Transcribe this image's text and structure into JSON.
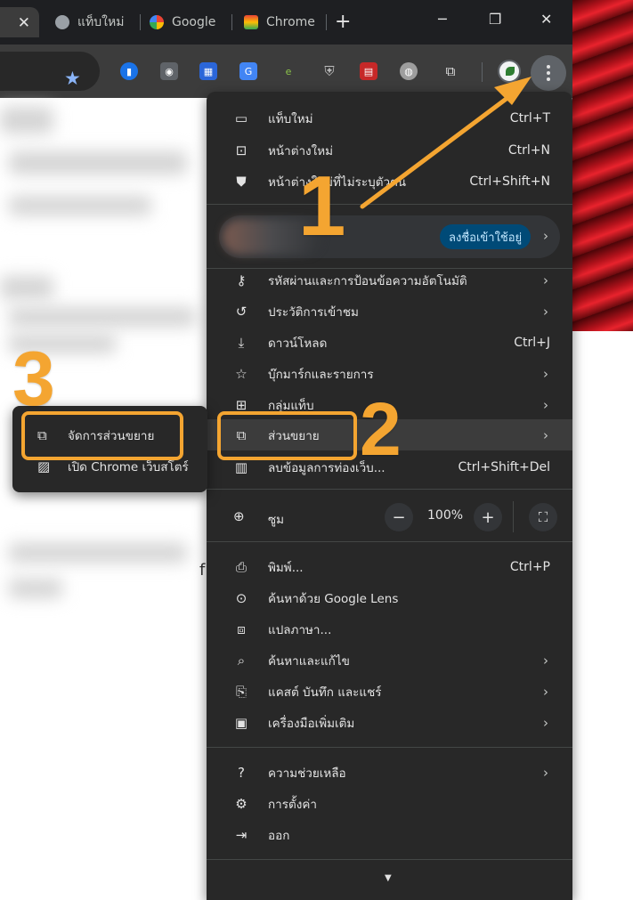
{
  "tabs": [
    {
      "label": "",
      "close": "✕"
    },
    {
      "label": "แท็บใหม่"
    },
    {
      "label": "Google"
    },
    {
      "label": "Chrome"
    }
  ],
  "newtab_icon": "+",
  "window": {
    "minimize": "─",
    "restore": "❐",
    "close": "✕"
  },
  "menu": {
    "section1": [
      {
        "label": "แท็บใหม่",
        "shortcut": "Ctrl+T",
        "icon": "new-tab-icon"
      },
      {
        "label": "หน้าต่างใหม่",
        "shortcut": "Ctrl+N",
        "icon": "new-window-icon"
      },
      {
        "label": "หน้าต่างใหม่ที่ไม่ระบุตัวตน",
        "shortcut": "Ctrl+Shift+N",
        "icon": "incognito-icon"
      }
    ],
    "signin_label": "ลงชื่อเข้าใช้อยู่",
    "section2": [
      {
        "label": "รหัสผ่านและการป้อนข้อความอัตโนมัติ",
        "shortcut": "",
        "icon": "key-icon"
      },
      {
        "label": "ประวัติการเข้าชม",
        "shortcut": "",
        "icon": "history-icon"
      },
      {
        "label": "ดาวน์โหลด",
        "shortcut": "Ctrl+J",
        "icon": "download-icon"
      },
      {
        "label": "บุ๊กมาร์กและรายการ",
        "shortcut": "",
        "icon": "star-icon"
      },
      {
        "label": "กลุ่มแท็บ",
        "shortcut": "",
        "icon": "grid-icon"
      },
      {
        "label": "ส่วนขยาย",
        "shortcut": "",
        "icon": "puzzle-icon"
      },
      {
        "label": "ลบข้อมูลการท่องเว็บ...",
        "shortcut": "Ctrl+Shift+Del",
        "icon": "trash-icon"
      }
    ],
    "zoom": {
      "label": "ซูม",
      "value": "100%",
      "minus": "−",
      "plus": "+"
    },
    "section3": [
      {
        "label": "พิมพ์...",
        "shortcut": "Ctrl+P",
        "icon": "print-icon"
      },
      {
        "label": "ค้นหาด้วย Google Lens",
        "shortcut": "",
        "icon": "lens-icon"
      },
      {
        "label": "แปลภาษา...",
        "shortcut": "",
        "icon": "translate-icon"
      },
      {
        "label": "ค้นหาและแก้ไข",
        "shortcut": "",
        "icon": "find-icon"
      },
      {
        "label": "แคสต์ บันทึก และแชร์",
        "shortcut": "",
        "icon": "cast-icon"
      },
      {
        "label": "เครื่องมือเพิ่มเติม",
        "shortcut": "",
        "icon": "toolbox-icon"
      }
    ],
    "section4": [
      {
        "label": "ความช่วยเหลือ",
        "shortcut": "",
        "icon": "help-icon"
      },
      {
        "label": "การตั้งค่า",
        "shortcut": "",
        "icon": "settings-icon"
      },
      {
        "label": "ออก",
        "shortcut": "",
        "icon": "exit-icon"
      }
    ]
  },
  "submenu": [
    {
      "label": "จัดการส่วนขยาย",
      "icon": "puzzle-icon"
    },
    {
      "label": "เปิด Chrome เว็บสโตร์",
      "icon": "webstore-icon"
    }
  ],
  "page_fragment": "f",
  "annotations": {
    "step1": "1",
    "step2": "2",
    "step3": "3"
  },
  "colors": {
    "highlight": "#f4a531",
    "menu_bg": "#282828",
    "signin_bg": "#004a77"
  }
}
